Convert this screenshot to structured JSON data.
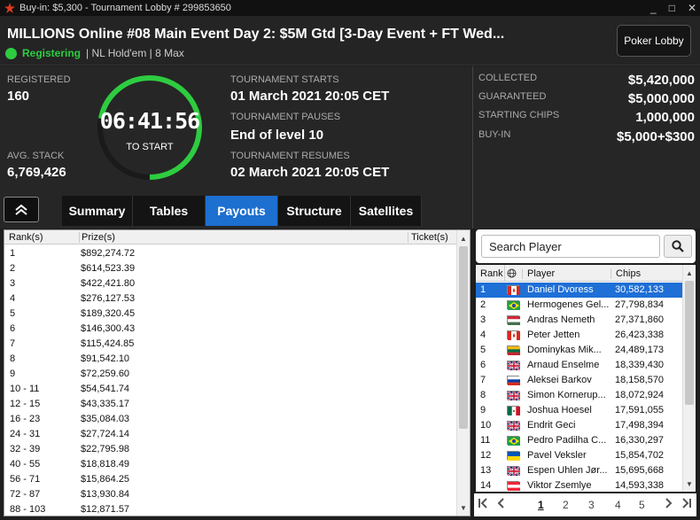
{
  "titlebar": {
    "text": "Buy-in: $5,300 - Tournament Lobby # 299853650",
    "minimize": "_",
    "maximize": "□",
    "close": "✕"
  },
  "header": {
    "title": "MILLIONS Online #08 Main Event Day 2: $5M Gtd [3-Day Event + FT Wed...",
    "status": "Registering",
    "game": "| NL Hold'em | 8 Max",
    "lobby_button": "Poker Lobby"
  },
  "info": {
    "registered_label": "REGISTERED",
    "registered_value": "160",
    "avg_stack_label": "AVG. STACK",
    "avg_stack_value": "6,769,426",
    "clock_time": "06:41:56",
    "clock_sub": "TO START",
    "clock_progress": 0.72,
    "starts_label": "TOURNAMENT STARTS",
    "starts_value": "01 March 2021  20:05 CET",
    "pauses_label": "TOURNAMENT PAUSES",
    "pauses_value": "End of level 10",
    "resumes_label": "TOURNAMENT RESUMES",
    "resumes_value": "02 March 2021  20:05 CET",
    "collected_label": "COLLECTED",
    "collected_value": "$5,420,000",
    "guaranteed_label": "GUARANTEED",
    "guaranteed_value": "$5,000,000",
    "chips_label": "STARTING CHIPS",
    "chips_value": "1,000,000",
    "buyin_label": "BUY-IN",
    "buyin_value": "$5,000+$300"
  },
  "tabs": [
    {
      "label": "Summary",
      "active": false
    },
    {
      "label": "Tables",
      "active": false
    },
    {
      "label": "Payouts",
      "active": true
    },
    {
      "label": "Structure",
      "active": false
    },
    {
      "label": "Satellites",
      "active": false
    }
  ],
  "payouts": {
    "headers": {
      "rank": "Rank(s)",
      "prize": "Prize(s)",
      "ticket": "Ticket(s)"
    },
    "rows": [
      {
        "rank": "1",
        "prize": "$892,274.72"
      },
      {
        "rank": "2",
        "prize": "$614,523.39"
      },
      {
        "rank": "3",
        "prize": "$422,421.80"
      },
      {
        "rank": "4",
        "prize": "$276,127.53"
      },
      {
        "rank": "5",
        "prize": "$189,320.45"
      },
      {
        "rank": "6",
        "prize": "$146,300.43"
      },
      {
        "rank": "7",
        "prize": "$115,424.85"
      },
      {
        "rank": "8",
        "prize": "$91,542.10"
      },
      {
        "rank": "9",
        "prize": "$72,259.60"
      },
      {
        "rank": "10 - 11",
        "prize": "$54,541.74"
      },
      {
        "rank": "12 - 15",
        "prize": "$43,335.17"
      },
      {
        "rank": "16 - 23",
        "prize": "$35,084.03"
      },
      {
        "rank": "24 - 31",
        "prize": "$27,724.14"
      },
      {
        "rank": "32 - 39",
        "prize": "$22,795.98"
      },
      {
        "rank": "40 - 55",
        "prize": "$18,818.49"
      },
      {
        "rank": "56 - 71",
        "prize": "$15,864.25"
      },
      {
        "rank": "72 - 87",
        "prize": "$13,930.84"
      },
      {
        "rank": "88 - 103",
        "prize": "$12,871.57"
      }
    ]
  },
  "players": {
    "search_placeholder": "Search Player",
    "headers": {
      "rank": "Rank",
      "player": "Player",
      "chips": "Chips"
    },
    "rows": [
      {
        "rank": "1",
        "name": "Daniel Dvoress",
        "chips": "30,582,133",
        "flag": "canada",
        "selected": true
      },
      {
        "rank": "2",
        "name": "Hermogenes Gel...",
        "chips": "27,798,834",
        "flag": "brazil"
      },
      {
        "rank": "3",
        "name": "Andras Nemeth",
        "chips": "27,371,860",
        "flag": "hungary"
      },
      {
        "rank": "4",
        "name": "Peter Jetten",
        "chips": "26,423,338",
        "flag": "canada"
      },
      {
        "rank": "5",
        "name": "Dominykas Mik...",
        "chips": "24,489,173",
        "flag": "lithuania"
      },
      {
        "rank": "6",
        "name": "Arnaud Enselme",
        "chips": "18,339,430",
        "flag": "uk"
      },
      {
        "rank": "7",
        "name": "Aleksei Barkov",
        "chips": "18,158,570",
        "flag": "russia"
      },
      {
        "rank": "8",
        "name": "Simon Kornerup...",
        "chips": "18,072,924",
        "flag": "uk"
      },
      {
        "rank": "9",
        "name": "Joshua Hoesel",
        "chips": "17,591,055",
        "flag": "mexico"
      },
      {
        "rank": "10",
        "name": "Endrit Geci",
        "chips": "17,498,394",
        "flag": "uk"
      },
      {
        "rank": "11",
        "name": "Pedro Padilha C...",
        "chips": "16,330,297",
        "flag": "brazil"
      },
      {
        "rank": "12",
        "name": "Pavel Veksler",
        "chips": "15,854,702",
        "flag": "ukraine"
      },
      {
        "rank": "13",
        "name": "Espen Uhlen Jør...",
        "chips": "15,695,668",
        "flag": "uk"
      },
      {
        "rank": "14",
        "name": "Viktor Zsemlye",
        "chips": "14,593,338",
        "flag": "austria"
      }
    ],
    "pages": [
      "1",
      "2",
      "3",
      "4",
      "5"
    ],
    "current_page": "1"
  },
  "colors": {
    "accent": "#1d6fd0",
    "registering": "#2ecc40"
  }
}
